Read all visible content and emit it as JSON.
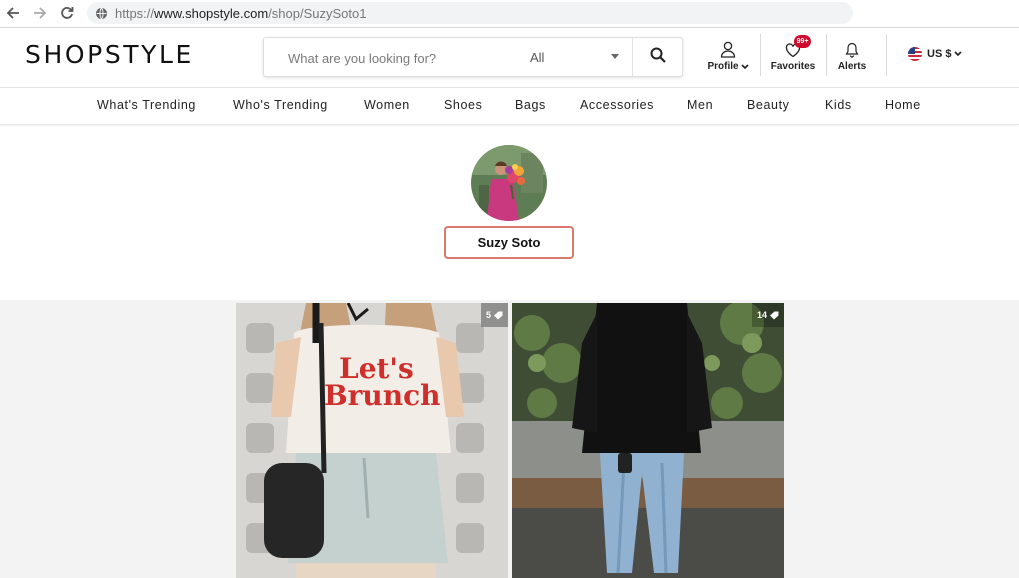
{
  "browser": {
    "url_protocol": "https://",
    "url_host": "www.shopstyle.com",
    "url_path": "/shop/SuzySoto1"
  },
  "header": {
    "logo": "SHOPSTYLE",
    "search": {
      "placeholder": "What are you looking for?",
      "category": "All"
    },
    "profile_label": "Profile",
    "favorites_label": "Favorites",
    "favorites_badge": "99+",
    "alerts_label": "Alerts",
    "currency": "US $"
  },
  "nav": {
    "items": [
      {
        "label": "What's Trending"
      },
      {
        "label": "Who's Trending"
      },
      {
        "label": "Women"
      },
      {
        "label": "Shoes"
      },
      {
        "label": "Bags"
      },
      {
        "label": "Accessories"
      },
      {
        "label": "Men"
      },
      {
        "label": "Beauty"
      },
      {
        "label": "Kids"
      },
      {
        "label": "Home"
      }
    ]
  },
  "profile": {
    "name": "Suzy Soto"
  },
  "feed": {
    "posts": [
      {
        "count": "5",
        "shirt_text_1": "Let's",
        "shirt_text_2": "Brunch"
      },
      {
        "count": "14"
      }
    ]
  },
  "colors": {
    "accent_border": "#d9796b",
    "badge": "#cf0a2c",
    "feed_bg": "#f3f3f3"
  }
}
